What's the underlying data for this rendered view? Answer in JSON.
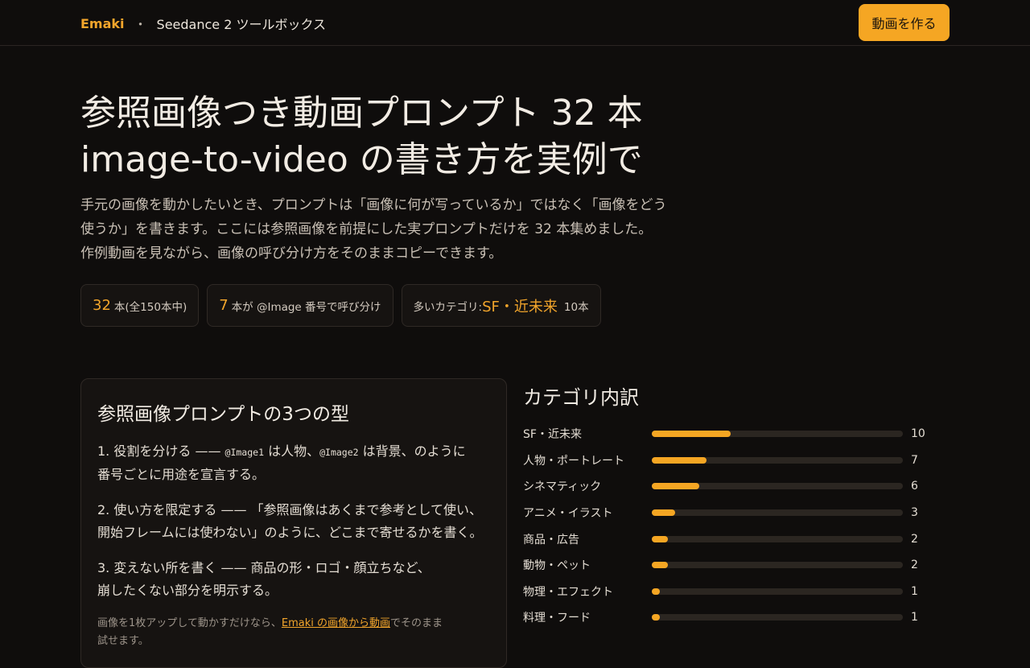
{
  "header": {
    "logo": "Emaki",
    "separator": "・",
    "subtitle": "Seedance 2 ツールボックス",
    "cta_label": "動画を作る"
  },
  "hero": {
    "title_line1": "参照画像つき動画プロンプト 32 本",
    "title_line2": "image-to-video の書き方を実例で",
    "desc_line1": "手元の画像を動かしたいとき、プロンプトは「画像に何が写っているか」ではなく「画像をどう",
    "desc_line2": "使うか」を書きます。ここには参照画像を前提にした実プロンプトだけを 32 本集めました。",
    "desc_line3": "作例動画を見ながら、画像の呼び分け方をそのままコピーできます。"
  },
  "stats": {
    "s1_num": "32",
    "s1_text": "本(全150本中)",
    "s2_num": "7",
    "s2_text": "本が @Image 番号で呼び分け",
    "s3_prefix": "多いカテゴリ:",
    "s3_highlight": "SF・近未来",
    "s3_count": "10本"
  },
  "patterns": {
    "title": "参照画像プロンプトの3つの型",
    "step1_a": "1. 役割を分ける —— ",
    "step1_code1": "@Image1",
    "step1_b": " は人物、",
    "step1_code2": "@Image2",
    "step1_c": " は背景、のように",
    "step1_d": "番号ごとに用途を宣言する。",
    "step2_a": "2. 使い方を限定する —— 「参照画像はあくまで参考として使い、",
    "step2_b": "開始フレームには使わない」のように、どこまで寄せるかを書く。",
    "step3_a": "3. 変えない所を書く —— 商品の形・ロゴ・顔立ちなど、",
    "step3_b": "崩したくない部分を明示する。",
    "note_a": "画像を1枚アップして動かすだけなら、",
    "note_link": "Emaki の画像から動画",
    "note_b": "でそのまま",
    "note_c": "試せます。"
  },
  "breakdown": {
    "title": "カテゴリ内訳",
    "max": 32,
    "rows": [
      {
        "label": "SF・近未来",
        "count": 10
      },
      {
        "label": "人物・ポートレート",
        "count": 7
      },
      {
        "label": "シネマティック",
        "count": 6
      },
      {
        "label": "アニメ・イラスト",
        "count": 3
      },
      {
        "label": "商品・広告",
        "count": 2
      },
      {
        "label": "動物・ペット",
        "count": 2
      },
      {
        "label": "物理・エフェクト",
        "count": 1
      },
      {
        "label": "料理・フード",
        "count": 1
      }
    ]
  },
  "colors": {
    "accent": "#f5a623",
    "background": "#0f0d0c",
    "track": "#2b2621"
  }
}
